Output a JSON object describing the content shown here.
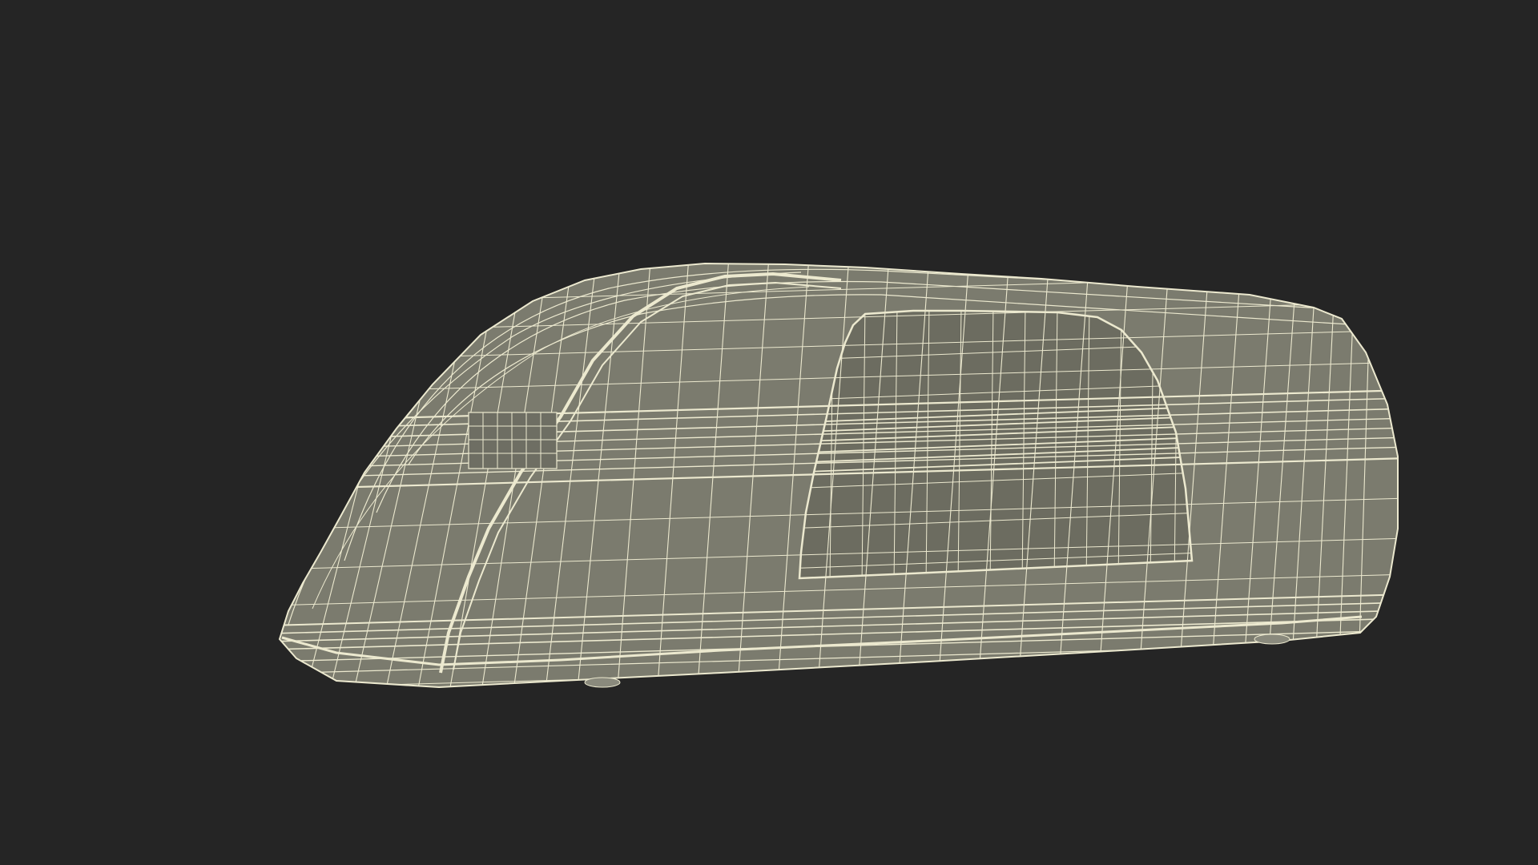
{
  "scene": {
    "background_color": "#252525",
    "object": {
      "kind": "3d-wireframe-model",
      "surface_color": "#7b7b6e",
      "shadow_color": "#6c6c60",
      "wire_color": "#ece9cf"
    }
  }
}
